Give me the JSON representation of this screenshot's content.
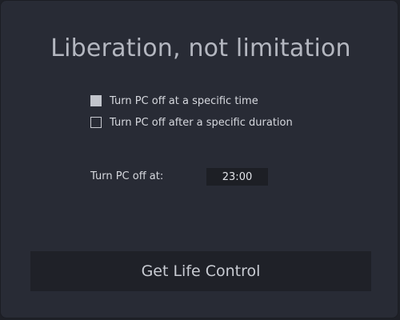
{
  "app": {
    "title": "Liberation, not limitation"
  },
  "options": [
    {
      "label": "Turn PC off at a specific time",
      "checked": true
    },
    {
      "label": "Turn PC off after a specific duration",
      "checked": false
    }
  ],
  "time_setting": {
    "label": "Turn PC off at:",
    "value": "23:00"
  },
  "action": {
    "label": "Get Life Control"
  },
  "colors": {
    "background": "#282b35",
    "button_background": "#1f2128",
    "checked_box": "#c2c5cc"
  }
}
